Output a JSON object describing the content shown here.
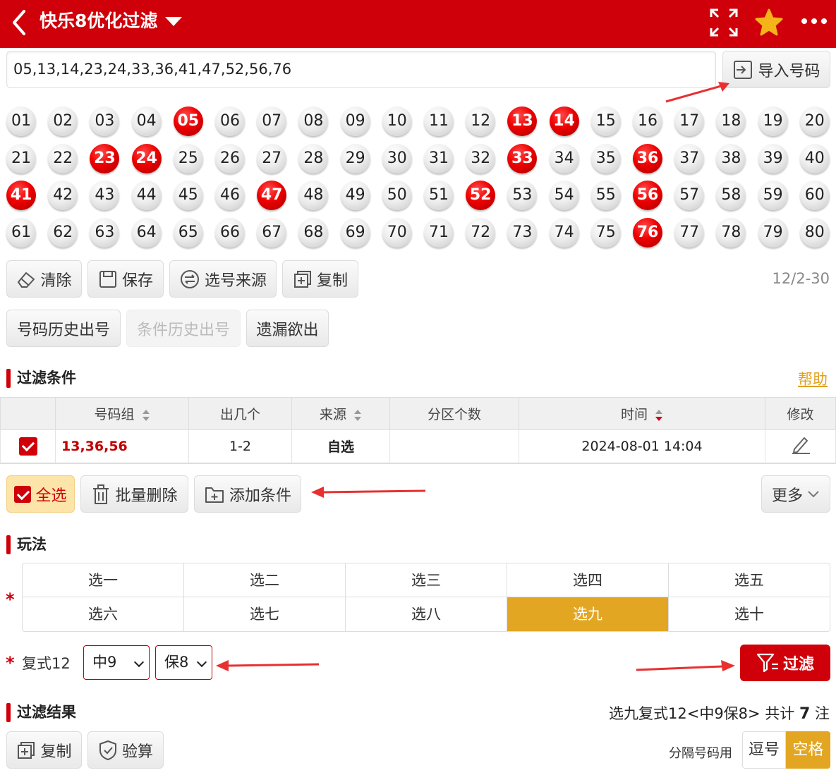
{
  "header": {
    "title": "快乐8优化过滤"
  },
  "input": {
    "numbers": "05,13,14,23,24,33,36,41,47,52,56,76",
    "import_label": "导入号码"
  },
  "balls": [
    "01",
    "02",
    "03",
    "04",
    "05",
    "06",
    "07",
    "08",
    "09",
    "10",
    "11",
    "12",
    "13",
    "14",
    "15",
    "16",
    "17",
    "18",
    "19",
    "20",
    "21",
    "22",
    "23",
    "24",
    "25",
    "26",
    "27",
    "28",
    "29",
    "30",
    "31",
    "32",
    "33",
    "34",
    "35",
    "36",
    "37",
    "38",
    "39",
    "40",
    "41",
    "42",
    "43",
    "44",
    "45",
    "46",
    "47",
    "48",
    "49",
    "50",
    "51",
    "52",
    "53",
    "54",
    "55",
    "56",
    "57",
    "58",
    "59",
    "60",
    "61",
    "62",
    "63",
    "64",
    "65",
    "66",
    "67",
    "68",
    "69",
    "70",
    "71",
    "72",
    "73",
    "74",
    "75",
    "76",
    "77",
    "78",
    "79",
    "80"
  ],
  "selected_balls": [
    "05",
    "13",
    "14",
    "23",
    "24",
    "33",
    "36",
    "41",
    "47",
    "52",
    "56",
    "76"
  ],
  "toolbar": {
    "clear": "清除",
    "save": "保存",
    "source": "选号来源",
    "copy": "复制",
    "count": "12/2-30"
  },
  "history": {
    "num_history": "号码历史出号",
    "cond_history": "条件历史出号",
    "missing": "遗漏欲出"
  },
  "conditions": {
    "title": "过滤条件",
    "help": "帮助",
    "columns": [
      "号码组",
      "出几个",
      "来源",
      "分区个数",
      "时间",
      "修改"
    ],
    "rows": [
      {
        "group": "13,36,56",
        "count": "1-2",
        "source": "自选",
        "zones": "",
        "time": "2024-08-01 14:04"
      }
    ],
    "select_all": "全选",
    "batch_delete": "批量删除",
    "add": "添加条件",
    "more": "更多"
  },
  "play": {
    "title": "玩法",
    "options": [
      "选一",
      "选二",
      "选三",
      "选四",
      "选五",
      "选六",
      "选七",
      "选八",
      "选九",
      "选十"
    ],
    "active": "选九",
    "compound_label": "复式12",
    "hit_select": "中9",
    "guarantee_select": "保8",
    "filter_button": "过滤"
  },
  "result": {
    "title": "过滤结果",
    "summary_prefix": "选九复式12<中9保8>  共计",
    "total": "7",
    "unit": "注",
    "copy": "复制",
    "verify": "验算",
    "separator_label": "分隔号码用",
    "sep_comma": "逗号",
    "sep_space": "空格"
  },
  "colors": {
    "brand": "#d0000a",
    "accent": "#e3a623"
  }
}
